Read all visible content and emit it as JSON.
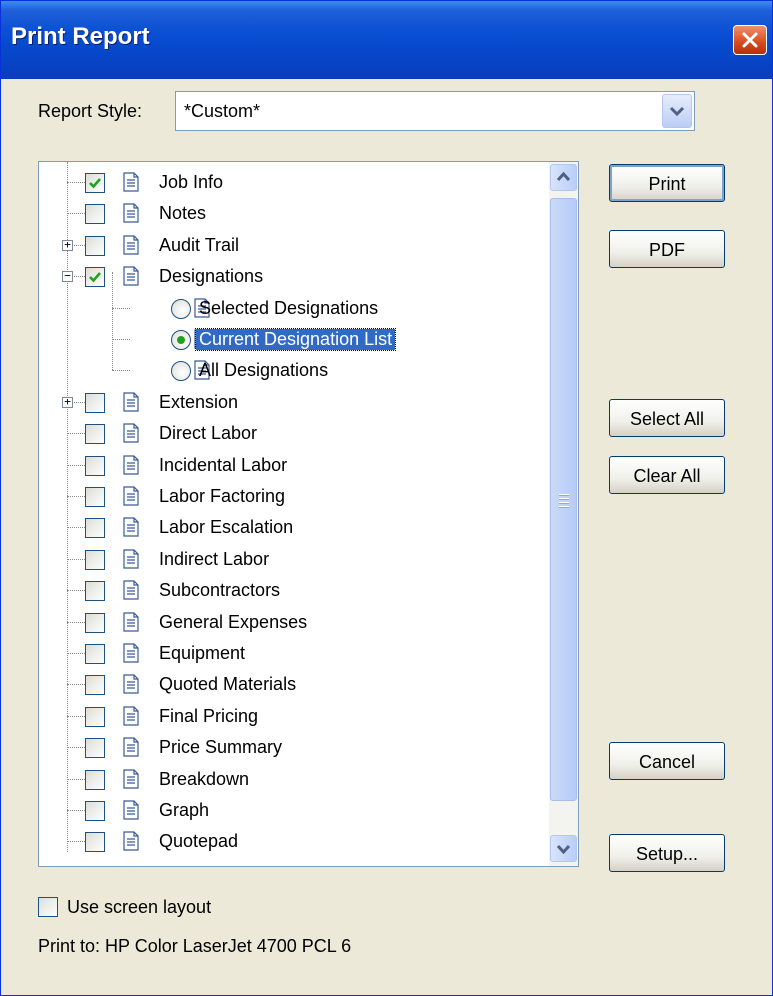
{
  "window": {
    "title": "Print Report"
  },
  "report_style": {
    "label": "Report Style:",
    "value": "*Custom*"
  },
  "tree": {
    "items": [
      {
        "label": "Job Info",
        "checked": true,
        "expander": null,
        "kind": "checkbox",
        "level": 0
      },
      {
        "label": "Notes",
        "checked": false,
        "expander": null,
        "kind": "checkbox",
        "level": 0
      },
      {
        "label": "Audit Trail",
        "checked": false,
        "expander": "+",
        "kind": "checkbox",
        "level": 0
      },
      {
        "label": "Designations",
        "checked": true,
        "expander": "−",
        "kind": "checkbox",
        "level": 0
      },
      {
        "label": "Selected Designations",
        "checked": false,
        "kind": "radio",
        "level": 1
      },
      {
        "label": "Current Designation List",
        "checked": true,
        "kind": "radio",
        "level": 1,
        "selected": true
      },
      {
        "label": "All Designations",
        "checked": false,
        "kind": "radio",
        "level": 1
      },
      {
        "label": "Extension",
        "checked": false,
        "expander": "+",
        "kind": "checkbox",
        "level": 0
      },
      {
        "label": "Direct Labor",
        "checked": false,
        "kind": "checkbox",
        "level": 0
      },
      {
        "label": "Incidental Labor",
        "checked": false,
        "kind": "checkbox",
        "level": 0
      },
      {
        "label": "Labor Factoring",
        "checked": false,
        "kind": "checkbox",
        "level": 0
      },
      {
        "label": "Labor Escalation",
        "checked": false,
        "kind": "checkbox",
        "level": 0
      },
      {
        "label": "Indirect Labor",
        "checked": false,
        "kind": "checkbox",
        "level": 0
      },
      {
        "label": "Subcontractors",
        "checked": false,
        "kind": "checkbox",
        "level": 0
      },
      {
        "label": "General Expenses",
        "checked": false,
        "kind": "checkbox",
        "level": 0
      },
      {
        "label": "Equipment",
        "checked": false,
        "kind": "checkbox",
        "level": 0
      },
      {
        "label": "Quoted Materials",
        "checked": false,
        "kind": "checkbox",
        "level": 0
      },
      {
        "label": "Final Pricing",
        "checked": false,
        "kind": "checkbox",
        "level": 0
      },
      {
        "label": "Price Summary",
        "checked": false,
        "kind": "checkbox",
        "level": 0
      },
      {
        "label": "Breakdown",
        "checked": false,
        "kind": "checkbox",
        "level": 0
      },
      {
        "label": "Graph",
        "checked": false,
        "kind": "checkbox",
        "level": 0
      },
      {
        "label": "Quotepad",
        "checked": false,
        "kind": "checkbox",
        "level": 0
      }
    ]
  },
  "buttons": {
    "print": "Print",
    "pdf": "PDF",
    "select_all": "Select All",
    "clear_all": "Clear All",
    "cancel": "Cancel",
    "setup": "Setup..."
  },
  "footer": {
    "use_screen_layout": "Use screen layout",
    "use_screen_layout_checked": false,
    "print_to": "Print to: HP Color LaserJet 4700 PCL 6"
  },
  "colors": {
    "titlebar": "#0A4FD4",
    "selection": "#316AC5",
    "dialog_bg": "#ECE9D8",
    "check": "#21A121"
  },
  "icons": [
    "close-icon",
    "chevron-down-icon",
    "document-icon",
    "checkmark-icon",
    "scroll-up-icon",
    "scroll-down-icon"
  ]
}
